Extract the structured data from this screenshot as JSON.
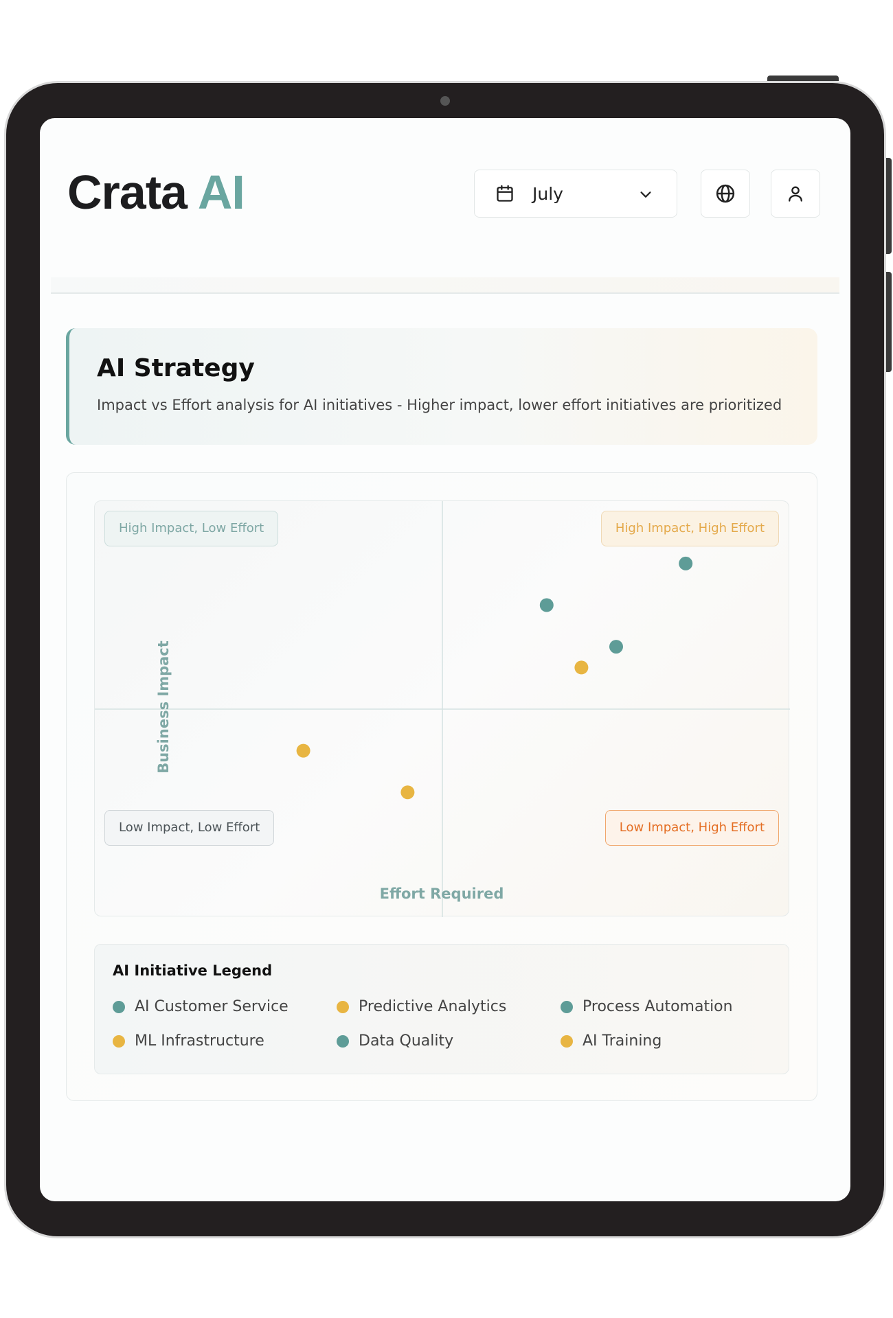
{
  "app": {
    "logo_primary": "Crata",
    "logo_accent": "AI"
  },
  "header": {
    "month_select": {
      "value": "July",
      "icon": "calendar-icon",
      "chevron": "chevron-down-icon"
    },
    "language_button": {
      "icon": "globe-icon"
    },
    "user_button": {
      "icon": "user-icon"
    }
  },
  "strategy": {
    "title": "AI Strategy",
    "description": "Impact vs Effort analysis for AI initiatives - Higher impact, lower effort initiatives are prioritized"
  },
  "colors": {
    "teal": "#6aa6a0",
    "amber": "#e8b542",
    "orange": "#e46d22",
    "text": "#1d1d1f"
  },
  "quadrants": {
    "top_left": "High Impact, Low Effort",
    "top_right": "High Impact, High Effort",
    "bottom_left": "Low Impact, Low Effort",
    "bottom_right": "Low Impact, High Effort"
  },
  "chart_data": {
    "type": "scatter",
    "xlabel": "Effort Required",
    "ylabel": "Business Impact",
    "xlim": [
      0,
      100
    ],
    "ylim": [
      0,
      100
    ],
    "grid": false,
    "points": [
      {
        "x": 85,
        "y": 85,
        "color": "#5e9c97"
      },
      {
        "x": 65,
        "y": 75,
        "color": "#5e9c97"
      },
      {
        "x": 75,
        "y": 65,
        "color": "#5e9c97"
      },
      {
        "x": 70,
        "y": 60,
        "color": "#e8b542"
      },
      {
        "x": 30,
        "y": 40,
        "color": "#e8b542"
      },
      {
        "x": 45,
        "y": 30,
        "color": "#e8b542"
      }
    ]
  },
  "legend": {
    "title": "AI Initiative Legend",
    "items": [
      {
        "label": "AI Customer Service",
        "color": "#5e9c97"
      },
      {
        "label": "Predictive Analytics",
        "color": "#e8b542"
      },
      {
        "label": "Process Automation",
        "color": "#5e9c97"
      },
      {
        "label": "ML Infrastructure",
        "color": "#e8b542"
      },
      {
        "label": "Data Quality",
        "color": "#5e9c97"
      },
      {
        "label": "AI Training",
        "color": "#e8b542"
      }
    ]
  }
}
